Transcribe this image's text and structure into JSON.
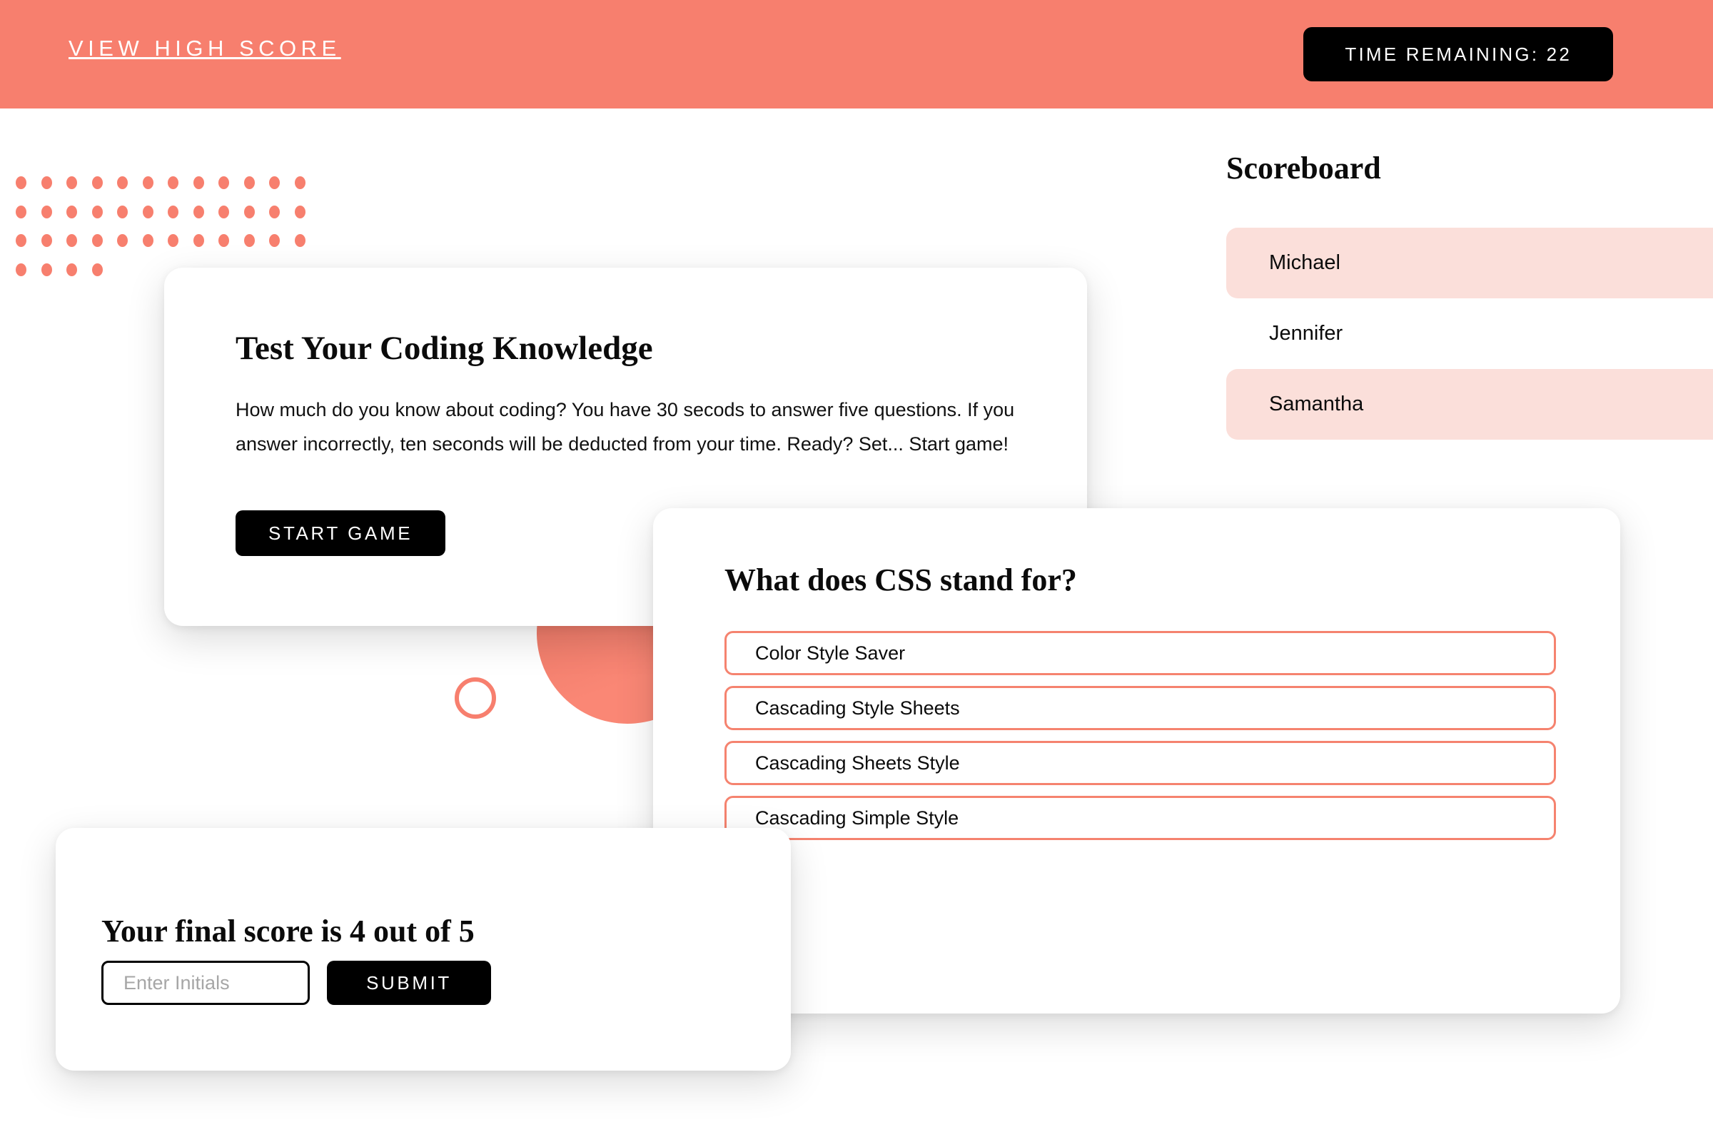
{
  "theme": {
    "accent": "#F77F6E",
    "accent_soft": "#FBDFDA",
    "button_bg": "#000000",
    "card_bg": "#FFFFFF"
  },
  "header": {
    "high_score_link": "View High Score",
    "timer_label": "Time Remaining: 22",
    "time_remaining": 22
  },
  "intro_card": {
    "title": "Test Your Coding Knowledge",
    "body": "How much do you know about coding? You have 30 secods to answer five questions. If you answer incorrectly, ten seconds will be deducted from your time. Ready? Set... Start game!",
    "start_label": "Start Game"
  },
  "quiz_card": {
    "question": "What does CSS stand for?",
    "answers": [
      "Color Style Saver",
      "Cascading Style Sheets",
      "Cascading Sheets Style",
      "Cascading Simple Style"
    ]
  },
  "score_card": {
    "title": "Your final score is 4 out of 5",
    "score": 4,
    "total": 5,
    "initials_value": "",
    "initials_placeholder": "Enter Initials",
    "submit_label": "Submit"
  },
  "scoreboard": {
    "title": "Scoreboard",
    "entries": [
      {
        "name": "Michael"
      },
      {
        "name": "Jennifer"
      },
      {
        "name": "Samantha"
      }
    ]
  },
  "decor": {
    "dot_columns": 12,
    "dot_rows": 4,
    "dot_last_row_count": 4
  }
}
